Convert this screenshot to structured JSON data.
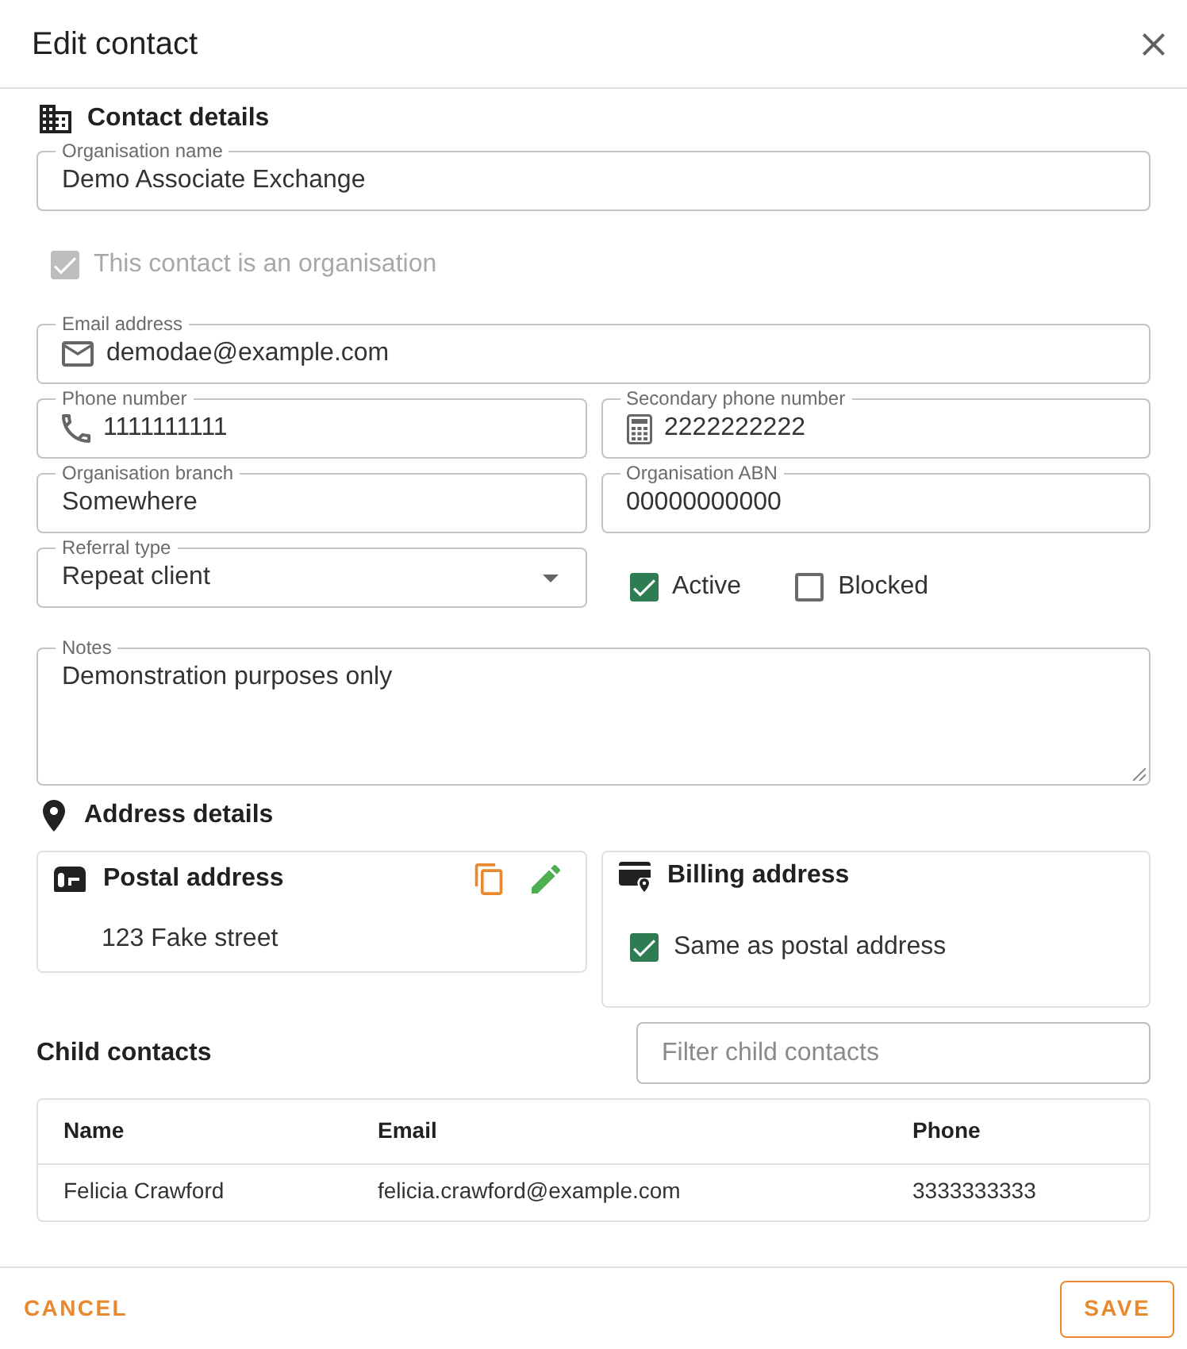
{
  "dialog": {
    "title": "Edit contact"
  },
  "contact_details": {
    "heading": "Contact details",
    "organisation_name": {
      "label": "Organisation name",
      "value": "Demo Associate Exchange"
    },
    "is_organisation": {
      "label": "This contact is an organisation",
      "checked": true,
      "disabled": true
    },
    "email": {
      "label": "Email address",
      "value": "demodae@example.com"
    },
    "phone": {
      "label": "Phone number",
      "value": "1111111111"
    },
    "secondary_phone": {
      "label": "Secondary phone number",
      "value": "2222222222"
    },
    "organisation_branch": {
      "label": "Organisation branch",
      "value": "Somewhere"
    },
    "organisation_abn": {
      "label": "Organisation ABN",
      "value": "00000000000"
    },
    "referral_type": {
      "label": "Referral type",
      "value": "Repeat client"
    },
    "flags": [
      {
        "label": "Active",
        "checked": true
      },
      {
        "label": "Blocked",
        "checked": false
      }
    ],
    "notes": {
      "label": "Notes",
      "value": "Demonstration purposes only"
    }
  },
  "address_details": {
    "heading": "Address details",
    "postal": {
      "title": "Postal address",
      "lines": [
        "123 Fake street"
      ]
    },
    "billing": {
      "title": "Billing address",
      "same_as_postal": {
        "label": "Same as postal address",
        "checked": true
      }
    }
  },
  "child_contacts": {
    "heading": "Child contacts",
    "filter": {
      "placeholder": "Filter child contacts"
    },
    "columns": [
      "Name",
      "Email",
      "Phone"
    ],
    "rows": [
      [
        "Felicia Crawford",
        "felicia.crawford@example.com",
        "3333333333"
      ]
    ]
  },
  "footer": {
    "buttons": [
      {
        "label": "CANCEL",
        "kind": "text"
      },
      {
        "label": "SAVE",
        "kind": "outlined"
      }
    ]
  }
}
